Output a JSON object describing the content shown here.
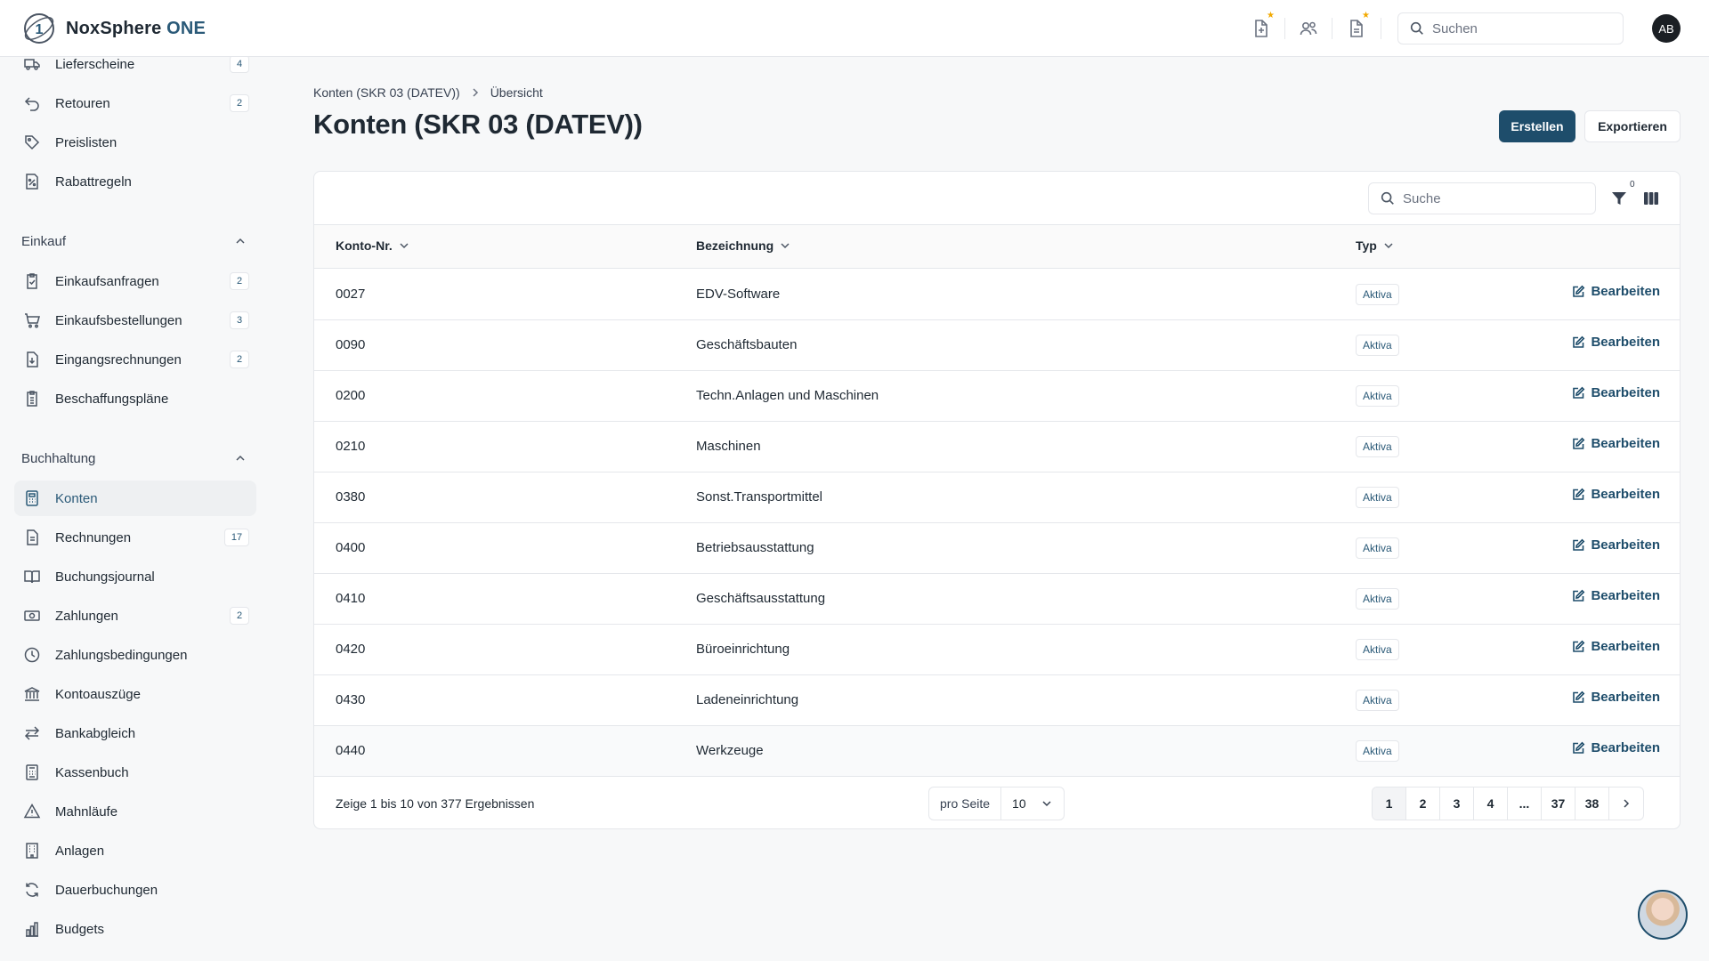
{
  "app": {
    "brand": "NoxSphere",
    "brand_suffix": "ONE"
  },
  "topbar": {
    "search_placeholder": "Suchen",
    "avatar_initials": "AB",
    "icons": [
      "file-plus-icon",
      "users-icon",
      "document-icon",
      "search-icon"
    ],
    "star_color": "#f2a900"
  },
  "sidebar": {
    "items_top": [
      {
        "label": "Lieferscheine",
        "badge": "4",
        "icon": "truck-icon"
      },
      {
        "label": "Retouren",
        "badge": "2",
        "icon": "return-arrow-icon"
      },
      {
        "label": "Preislisten",
        "badge": "",
        "icon": "tag-icon"
      },
      {
        "label": "Rabattregeln",
        "badge": "",
        "icon": "percent-icon"
      }
    ],
    "einkauf": {
      "title": "Einkauf",
      "items": [
        {
          "label": "Einkaufsanfragen",
          "badge": "2",
          "icon": "clipboard-check-icon"
        },
        {
          "label": "Einkaufsbestellungen",
          "badge": "3",
          "icon": "cart-icon"
        },
        {
          "label": "Eingangsrechnungen",
          "badge": "2",
          "icon": "invoice-in-icon"
        },
        {
          "label": "Beschaffungspläne",
          "badge": "",
          "icon": "clipboard-list-icon"
        }
      ]
    },
    "buchhaltung": {
      "title": "Buchhaltung",
      "items": [
        {
          "label": "Konten",
          "badge": "",
          "icon": "calculator-icon",
          "active": true
        },
        {
          "label": "Rechnungen",
          "badge": "17",
          "icon": "document-icon"
        },
        {
          "label": "Buchungsjournal",
          "badge": "",
          "icon": "book-icon"
        },
        {
          "label": "Zahlungen",
          "badge": "2",
          "icon": "banknote-icon"
        },
        {
          "label": "Zahlungsbedingungen",
          "badge": "",
          "icon": "clock-icon"
        },
        {
          "label": "Kontoauszüge",
          "badge": "",
          "icon": "bank-icon"
        },
        {
          "label": "Bankabgleich",
          "badge": "",
          "icon": "arrows-swap-icon"
        },
        {
          "label": "Kassenbuch",
          "badge": "",
          "icon": "register-icon"
        },
        {
          "label": "Mahnläufe",
          "badge": "",
          "icon": "warning-icon"
        },
        {
          "label": "Anlagen",
          "badge": "",
          "icon": "building-icon"
        },
        {
          "label": "Dauerbuchungen",
          "badge": "",
          "icon": "refresh-icon"
        },
        {
          "label": "Budgets",
          "badge": "",
          "icon": "bar-chart-icon"
        }
      ]
    }
  },
  "breadcrumb": {
    "parent": "Konten (SKR 03 (DATEV))",
    "current": "Übersicht"
  },
  "page": {
    "title": "Konten (SKR 03 (DATEV))",
    "create_label": "Erstellen",
    "export_label": "Exportieren"
  },
  "table": {
    "search_placeholder": "Suche",
    "filter_count": "0",
    "columns": {
      "number": "Konto-Nr.",
      "name": "Bezeichnung",
      "type": "Typ"
    },
    "edit_label": "Bearbeiten",
    "rows": [
      {
        "number": "0027",
        "name": "EDV-Software",
        "type": "Aktiva"
      },
      {
        "number": "0090",
        "name": "Geschäftsbauten",
        "type": "Aktiva"
      },
      {
        "number": "0200",
        "name": "Techn.Anlagen und Maschinen",
        "type": "Aktiva"
      },
      {
        "number": "0210",
        "name": "Maschinen",
        "type": "Aktiva"
      },
      {
        "number": "0380",
        "name": "Sonst.Transportmittel",
        "type": "Aktiva"
      },
      {
        "number": "0400",
        "name": "Betriebsausstattung",
        "type": "Aktiva"
      },
      {
        "number": "0410",
        "name": "Geschäftsausstattung",
        "type": "Aktiva"
      },
      {
        "number": "0420",
        "name": "Büroeinrichtung",
        "type": "Aktiva"
      },
      {
        "number": "0430",
        "name": "Ladeneinrichtung",
        "type": "Aktiva"
      },
      {
        "number": "0440",
        "name": "Werkzeuge",
        "type": "Aktiva"
      }
    ]
  },
  "pagination": {
    "info": "Zeige 1 bis 10 von 377 Ergebnissen",
    "per_page_label": "pro Seite",
    "per_page_value": "10",
    "pages": [
      "1",
      "2",
      "3",
      "4",
      "...",
      "37",
      "38"
    ],
    "current": "1"
  },
  "colors": {
    "primary": "#1e4d6b",
    "accent_text": "#2b5a78"
  }
}
